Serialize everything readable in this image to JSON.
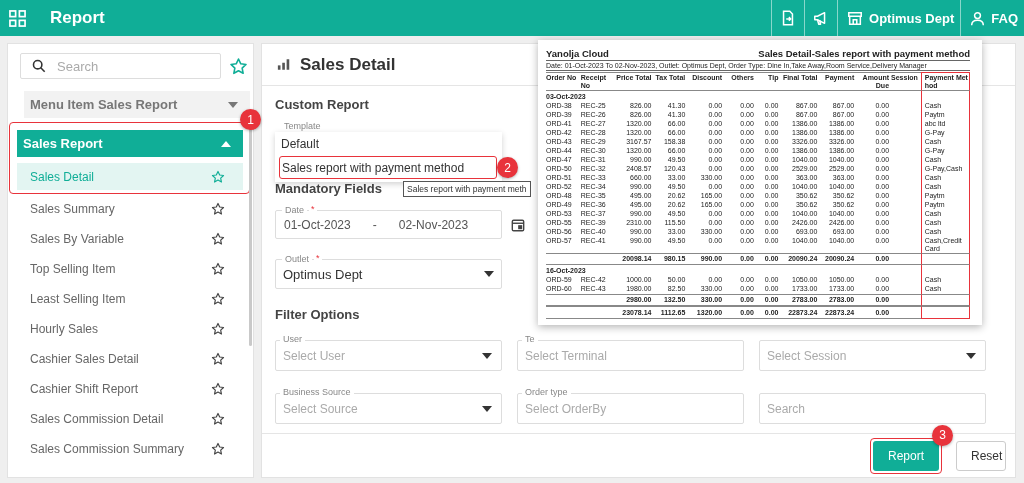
{
  "app_bar": {
    "title": "Report",
    "outlet": "Optimus Dept",
    "help": "FAQ"
  },
  "sidebar": {
    "search": {
      "placeholder": "Search"
    },
    "groups": [
      {
        "label": "Menu Item Sales Report",
        "expanded": false,
        "highlighted": false
      },
      {
        "label": "Sales Report",
        "expanded": true,
        "highlighted": true,
        "callout": "1",
        "items": [
          {
            "label": "Sales Detail",
            "selected": true,
            "highlighted": true
          },
          {
            "label": "Sales Summary",
            "selected": false,
            "highlighted": false
          },
          {
            "label": "Sales By Variable",
            "selected": false,
            "highlighted": false
          },
          {
            "label": "Top Selling Item",
            "selected": false,
            "highlighted": false
          },
          {
            "label": "Least Selling Item",
            "selected": false,
            "highlighted": false
          },
          {
            "label": "Hourly Sales",
            "selected": false,
            "highlighted": false
          },
          {
            "label": "Cashier Sales Detail",
            "selected": false,
            "highlighted": false
          },
          {
            "label": "Cashier Shift Report",
            "selected": false,
            "highlighted": false
          },
          {
            "label": "Sales Commission Detail",
            "selected": false,
            "highlighted": false
          },
          {
            "label": "Sales Commission Summary",
            "selected": false,
            "highlighted": false
          }
        ]
      }
    ]
  },
  "main": {
    "title": "Sales Detail",
    "custom_report": {
      "heading": "Custom Report",
      "template": {
        "label": "Template",
        "expanded": true,
        "tooltip": "Sales report with payment meth",
        "options": [
          {
            "label": "Default",
            "highlighted": false
          },
          {
            "label": "Sales report with payment method",
            "highlighted": true,
            "callout": "2"
          }
        ]
      }
    },
    "mandatory": {
      "heading": "Mandatory Fields",
      "date": {
        "label": "Date",
        "required_mark": "*",
        "from": "01-Oct-2023",
        "separator": "-",
        "to": "02-Nov-2023"
      },
      "outlet": {
        "label": "Outlet",
        "required_mark": "*",
        "value": "Optimus Dept"
      }
    },
    "filters": {
      "heading": "Filter Options",
      "fields": [
        {
          "kind": "select",
          "label": "User",
          "placeholder": "Select User"
        },
        {
          "kind": "plain",
          "label": "Te",
          "placeholder": "Select Terminal"
        },
        {
          "kind": "select",
          "placeholder": "Select Session"
        },
        {
          "kind": "select",
          "label": "Business Source",
          "placeholder": "Select Source"
        },
        {
          "kind": "plain",
          "label": "Order type",
          "placeholder": "Select OrderBy"
        },
        {
          "kind": "plain",
          "placeholder": "Search"
        }
      ]
    },
    "buttons": [
      {
        "label": "Report",
        "kind": "primary",
        "highlighted": true,
        "callout": "3"
      },
      {
        "label": "Reset",
        "kind": "secondary",
        "highlighted": false
      }
    ]
  },
  "report_preview": {
    "company": "Yanolja Cloud",
    "title": "Sales Detail-Sales report with payment method",
    "criteria": "Date: 01-Oct-2023 To 02-Nov-2023, Outlet: Optimus Dept, Order Type: Dine In,Take Away,Room Service,Delivery Manager",
    "columns": [
      {
        "label": "Order No",
        "kind": "text",
        "highlighted": false
      },
      {
        "label": "Receipt No",
        "kind": "text",
        "highlighted": false
      },
      {
        "label": "Price Total",
        "kind": "number",
        "highlighted": false
      },
      {
        "label": "Tax Total",
        "kind": "number",
        "highlighted": false
      },
      {
        "label": "Discount",
        "kind": "number",
        "highlighted": false
      },
      {
        "label": "Others",
        "kind": "number",
        "highlighted": false
      },
      {
        "label": "Tip",
        "kind": "number",
        "highlighted": false
      },
      {
        "label": "Final Total",
        "kind": "number",
        "highlighted": false
      },
      {
        "label": "Payment",
        "kind": "number",
        "highlighted": false
      },
      {
        "label": "Amount Due",
        "kind": "number",
        "highlighted": false
      },
      {
        "label": "Session",
        "kind": "empty",
        "highlighted": false
      },
      {
        "label": "Payment Method",
        "kind": "text",
        "highlighted": true
      }
    ],
    "groups": [
      {
        "date": "03-Oct-2023",
        "rows": [
          [
            "ORD-38",
            "REC-25",
            "826.00",
            "41.30",
            "0.00",
            "0.00",
            "0.00",
            "867.00",
            "867.00",
            "0.00",
            "Cash"
          ],
          [
            "ORD-39",
            "REC-26",
            "826.00",
            "41.30",
            "0.00",
            "0.00",
            "0.00",
            "867.00",
            "867.00",
            "0.00",
            "Paytm"
          ],
          [
            "ORD-41",
            "REC-27",
            "1320.00",
            "66.00",
            "0.00",
            "0.00",
            "0.00",
            "1386.00",
            "1386.00",
            "0.00",
            "abc ltd"
          ],
          [
            "ORD-42",
            "REC-28",
            "1320.00",
            "66.00",
            "0.00",
            "0.00",
            "0.00",
            "1386.00",
            "1386.00",
            "0.00",
            "G-Pay"
          ],
          [
            "ORD-43",
            "REC-29",
            "3167.57",
            "158.38",
            "0.00",
            "0.00",
            "0.00",
            "3326.00",
            "3326.00",
            "0.00",
            "Cash"
          ],
          [
            "ORD-44",
            "REC-30",
            "1320.00",
            "66.00",
            "0.00",
            "0.00",
            "0.00",
            "1386.00",
            "1386.00",
            "0.00",
            "G-Pay"
          ],
          [
            "ORD-47",
            "REC-31",
            "990.00",
            "49.50",
            "0.00",
            "0.00",
            "0.00",
            "1040.00",
            "1040.00",
            "0.00",
            "Cash"
          ],
          [
            "ORD-50",
            "REC-32",
            "2408.57",
            "120.43",
            "0.00",
            "0.00",
            "0.00",
            "2529.00",
            "2529.00",
            "0.00",
            "G-Pay,Cash"
          ],
          [
            "ORD-51",
            "REC-33",
            "660.00",
            "33.00",
            "330.00",
            "0.00",
            "0.00",
            "363.00",
            "363.00",
            "0.00",
            "Cash"
          ],
          [
            "ORD-52",
            "REC-34",
            "990.00",
            "49.50",
            "0.00",
            "0.00",
            "0.00",
            "1040.00",
            "1040.00",
            "0.00",
            "Cash"
          ],
          [
            "ORD-48",
            "REC-35",
            "495.00",
            "20.62",
            "165.00",
            "0.00",
            "0.00",
            "350.62",
            "350.62",
            "0.00",
            "Paytm"
          ],
          [
            "ORD-49",
            "REC-36",
            "495.00",
            "20.62",
            "165.00",
            "0.00",
            "0.00",
            "350.62",
            "350.62",
            "0.00",
            "Paytm"
          ],
          [
            "ORD-53",
            "REC-37",
            "990.00",
            "49.50",
            "0.00",
            "0.00",
            "0.00",
            "1040.00",
            "1040.00",
            "0.00",
            "Cash"
          ],
          [
            "ORD-55",
            "REC-39",
            "2310.00",
            "115.50",
            "0.00",
            "0.00",
            "0.00",
            "2426.00",
            "2426.00",
            "0.00",
            "Cash"
          ],
          [
            "ORD-56",
            "REC-40",
            "990.00",
            "33.00",
            "330.00",
            "0.00",
            "0.00",
            "693.00",
            "693.00",
            "0.00",
            "Cash"
          ],
          [
            "ORD-57",
            "REC-41",
            "990.00",
            "49.50",
            "0.00",
            "0.00",
            "0.00",
            "1040.00",
            "1040.00",
            "0.00",
            "Cash,Credit Card"
          ]
        ],
        "subtotal": [
          "20098.14",
          "980.15",
          "990.00",
          "0.00",
          "0.00",
          "20090.24",
          "20090.24",
          "0.00"
        ]
      },
      {
        "date": "16-Oct-2023",
        "rows": [
          [
            "ORD-59",
            "REC-42",
            "1000.00",
            "50.00",
            "0.00",
            "0.00",
            "0.00",
            "1050.00",
            "1050.00",
            "0.00",
            "Cash"
          ],
          [
            "ORD-60",
            "REC-43",
            "1980.00",
            "82.50",
            "330.00",
            "0.00",
            "0.00",
            "1733.00",
            "1733.00",
            "0.00",
            "Cash"
          ]
        ],
        "subtotal": [
          "2980.00",
          "132.50",
          "330.00",
          "0.00",
          "0.00",
          "2783.00",
          "2783.00",
          "0.00"
        ]
      }
    ],
    "grand_total": [
      "23078.14",
      "1112.65",
      "1320.00",
      "0.00",
      "0.00",
      "22873.24",
      "22873.24",
      "0.00"
    ]
  }
}
